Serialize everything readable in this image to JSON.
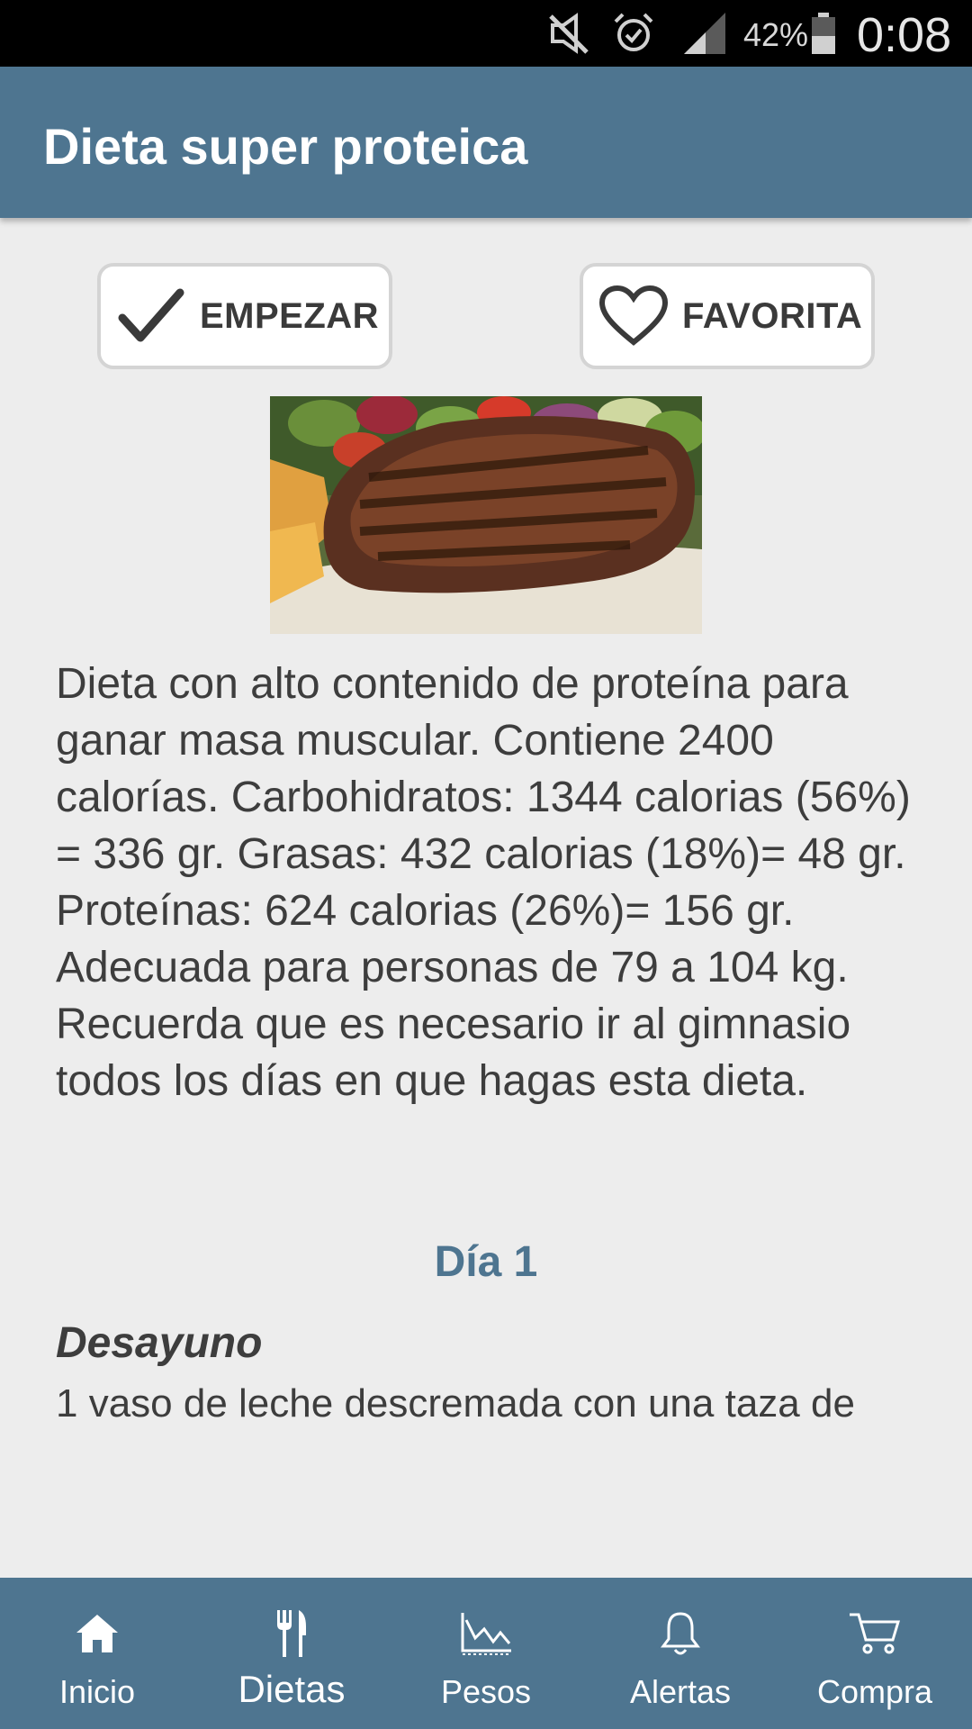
{
  "status_bar": {
    "battery_percent": "42%",
    "time": "0:08",
    "icons": [
      "mute-icon",
      "alarm-icon",
      "signal-icon",
      "battery-icon"
    ]
  },
  "header": {
    "title": "Dieta super proteica"
  },
  "actions": {
    "start_label": "EMPEZAR",
    "favorite_label": "FAVORITA"
  },
  "hero_image": {
    "subject": "grilled steak with salad"
  },
  "description": "Dieta con alto contenido de proteína para ganar masa muscular. Contiene 2400 calorías. Carbohidratos: 1344 calorias (56%) = 336 gr. Grasas: 432 calorias (18%)= 48 gr. Proteínas: 624 calorias (26%)= 156 gr. Adecuada para personas de 79 a 104 kg. Recuerda que es necesario ir al gimnasio todos los días en que hagas esta dieta.",
  "day": {
    "title": "Día 1",
    "meal_title": "Desayuno",
    "meal_text": "1 vaso de leche descremada con una taza de"
  },
  "colors": {
    "accent": "#4e7590",
    "background": "#ededed"
  },
  "bottom_nav": {
    "items": [
      {
        "label": "Inicio",
        "icon": "home-icon"
      },
      {
        "label": "Dietas",
        "icon": "fork-knife-icon",
        "active": true
      },
      {
        "label": "Pesos",
        "icon": "chart-icon"
      },
      {
        "label": "Alertas",
        "icon": "bell-icon"
      },
      {
        "label": "Compra",
        "icon": "cart-icon"
      }
    ]
  }
}
